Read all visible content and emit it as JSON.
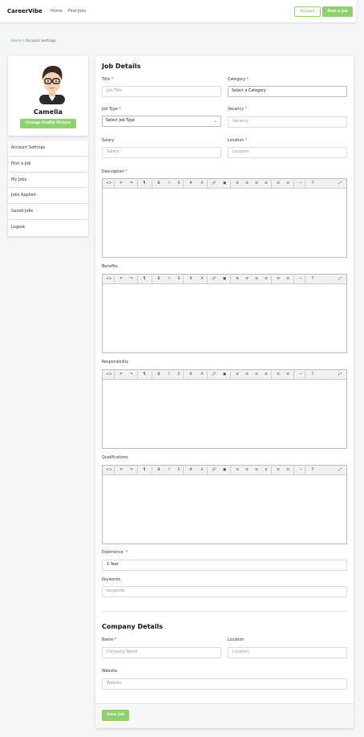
{
  "brand": "CareerVibe",
  "nav": [
    "Home",
    "Find Jobs"
  ],
  "header_buttons": {
    "account": "Account",
    "post_job": "Post a Job"
  },
  "breadcrumb": {
    "home": "Home",
    "sep": "/",
    "current": "Account Settings"
  },
  "profile": {
    "name": "Camelia",
    "change_picture": "Change Profile Picture"
  },
  "menu": [
    "Account Settings",
    "Post a Job",
    "My Jobs",
    "Jobs Applied",
    "Saved Jobs",
    "Logout"
  ],
  "job_details": {
    "heading": "Job Details",
    "title": {
      "label": "Title",
      "placeholder": "Job Title"
    },
    "category": {
      "label": "Category",
      "value": "Select a Category"
    },
    "job_type": {
      "label": "Job Type",
      "value": "Select Job Type"
    },
    "vacancy": {
      "label": "Vacancy",
      "placeholder": "Vacancy"
    },
    "salary": {
      "label": "Salary",
      "placeholder": "Salary"
    },
    "location": {
      "label": "Location",
      "placeholder": "Location"
    },
    "description": {
      "label": "Description"
    },
    "benefits": {
      "label": "Benefits"
    },
    "responsibility": {
      "label": "Responsibility"
    },
    "qualifications": {
      "label": "Qualifications"
    },
    "experience": {
      "label": "Experience",
      "value": "1 Year"
    },
    "keywords": {
      "label": "Keywords",
      "placeholder": "keywords"
    }
  },
  "required_mark": "*",
  "company_details": {
    "heading": "Company Details",
    "name": {
      "label": "Name",
      "placeholder": "Company Name"
    },
    "location": {
      "label": "Location",
      "placeholder": "Location"
    },
    "website": {
      "label": "Website",
      "placeholder": "Website"
    }
  },
  "save_button": "Save Job",
  "toolbar_glyphs": [
    "<>",
    "↶",
    "↷",
    "¶",
    "B",
    "I",
    "S",
    "#",
    "A",
    "🔗",
    "▣",
    "≡",
    "≡",
    "≡",
    "≡",
    "≡",
    "≡",
    "—",
    "T",
    "⤢"
  ],
  "colors": {
    "accent": "#8fd16f",
    "required": "#e0443a"
  }
}
